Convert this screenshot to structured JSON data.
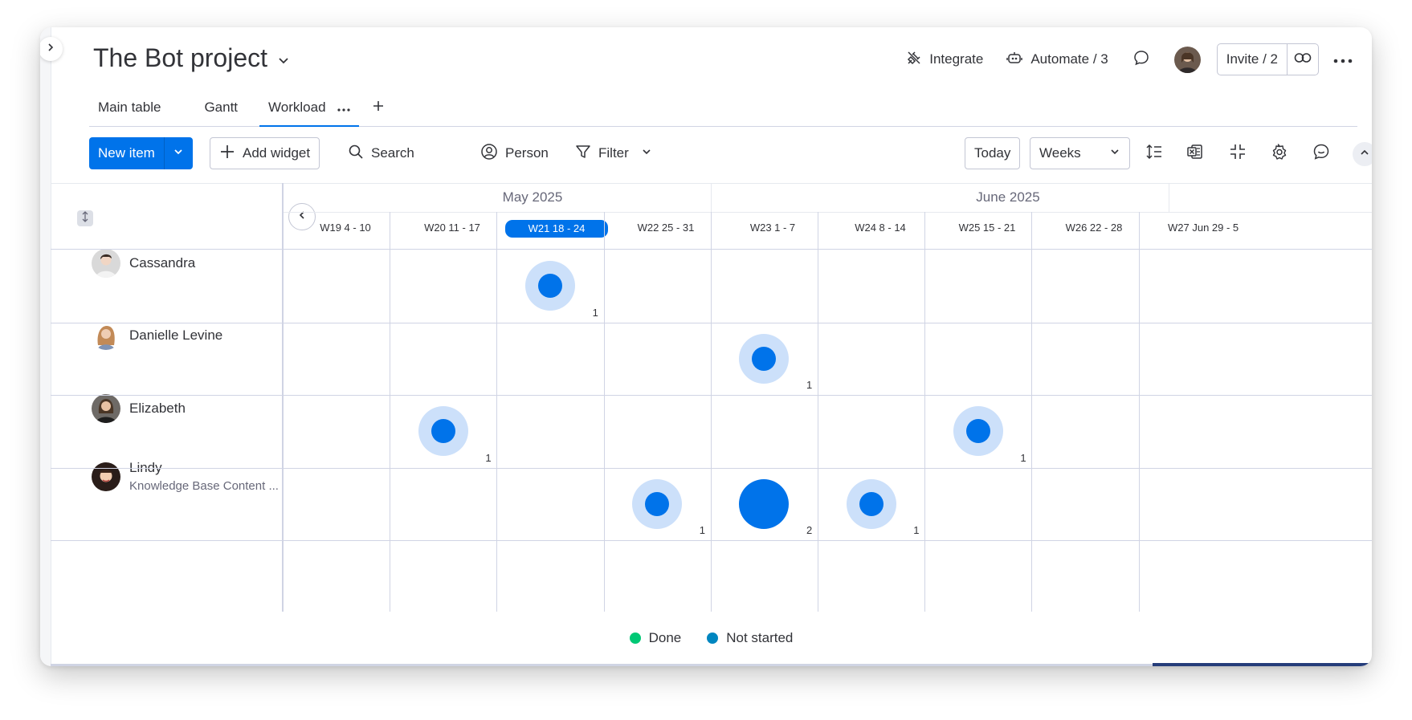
{
  "project": {
    "title": "The Bot project"
  },
  "header": {
    "integrate_label": "Integrate",
    "automate_label": "Automate / 3",
    "invite_label": "Invite / 2"
  },
  "tabs": [
    {
      "label": "Main table",
      "active": false
    },
    {
      "label": "Gantt",
      "active": false
    },
    {
      "label": "Workload",
      "active": true
    }
  ],
  "toolbar": {
    "new_item_label": "New item",
    "add_widget_label": "Add widget",
    "search_label": "Search",
    "person_label": "Person",
    "filter_label": "Filter",
    "today_label": "Today",
    "scale_value": "Weeks"
  },
  "timeline": {
    "months": [
      "May 2025",
      "June 2025"
    ],
    "weeks": [
      {
        "label": "W19 4 - 10",
        "current": false
      },
      {
        "label": "W20 11 - 17",
        "current": false
      },
      {
        "label": "W21 18 - 24",
        "current": true
      },
      {
        "label": "W22 25 - 31",
        "current": false
      },
      {
        "label": "W23 1 - 7",
        "current": false
      },
      {
        "label": "W24 8 - 14",
        "current": false
      },
      {
        "label": "W25 15 - 21",
        "current": false
      },
      {
        "label": "W26 22 - 28",
        "current": false
      },
      {
        "label": "W27 Jun 29 - 5",
        "current": false
      }
    ]
  },
  "people": [
    {
      "name": "Cassandra",
      "subtitle": "",
      "workload": [
        {
          "week": 2,
          "count": 1
        }
      ]
    },
    {
      "name": "Danielle Levine",
      "subtitle": "",
      "workload": [
        {
          "week": 4,
          "count": 1
        }
      ]
    },
    {
      "name": "Elizabeth",
      "subtitle": "",
      "workload": [
        {
          "week": 1,
          "count": 1
        },
        {
          "week": 6,
          "count": 1
        }
      ]
    },
    {
      "name": "Lindy",
      "subtitle": "Knowledge Base Content ...",
      "workload": [
        {
          "week": 3,
          "count": 1
        },
        {
          "week": 4,
          "count": 2
        },
        {
          "week": 5,
          "count": 1
        }
      ]
    }
  ],
  "legend": [
    {
      "label": "Done",
      "color": "#00c875"
    },
    {
      "label": "Not started",
      "color": "#0086c0"
    }
  ],
  "colors": {
    "accent": "#0073ea",
    "bubble_inner": "#0073ea",
    "bubble_halo": "#cce0fa"
  }
}
